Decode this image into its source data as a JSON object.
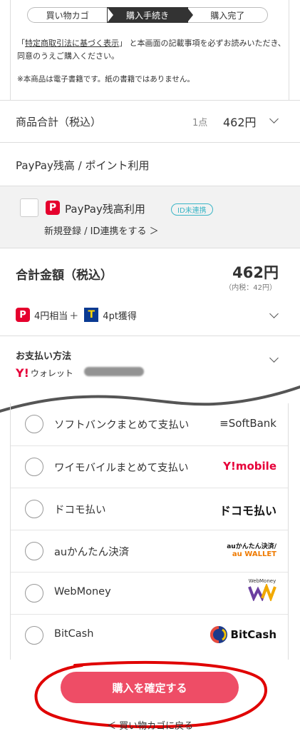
{
  "steps": [
    {
      "label": "買い物カゴ"
    },
    {
      "label": "購入手続き"
    },
    {
      "label": "購入完了"
    }
  ],
  "notice": {
    "quote_open": "「",
    "link": "特定商取引法に基づく表示",
    "quote_close": "」",
    "text": "と本画面の記載事項を必ずお読みいただき、同意のうえご購入ください。",
    "ebook_note": "※本商品は電子書籍です。紙の書籍ではありません。"
  },
  "subtotal": {
    "label": "商品合計（税込）",
    "count": "1点",
    "amount": "462円"
  },
  "paypay": {
    "section_title": "PayPay残高 / ポイント利用",
    "logo_glyph": "P",
    "use_label": "PayPay残高利用",
    "badge": "ID未連携",
    "link": "新規登録 / ID連携をする ＞"
  },
  "total": {
    "label": "合計金額（税込）",
    "amount": "462円",
    "tax": "（内税：42円）",
    "pp_points": "4円相当",
    "plus": "＋",
    "t_glyph": "T",
    "t_points": "4pt獲得"
  },
  "payment_method": {
    "label": "お支払い方法",
    "y_glyph": "Y!",
    "wallet": "ウォレット"
  },
  "options": [
    {
      "label": "ソフトバンクまとめて支払い",
      "logo": "≡SoftBank",
      "logo_color": "#333333"
    },
    {
      "label": "ワイモバイルまとめて支払い",
      "logo": "Y!mobile",
      "logo_color": "#e60039"
    },
    {
      "label": "ドコモ払い",
      "logo": "ドコモ払い",
      "logo_color": "#111111"
    },
    {
      "label": "auかんたん決済",
      "logo": "auかんたん決済/",
      "logo_sub": "au WALLET",
      "logo_color": "#111111"
    },
    {
      "label": "WebMoney",
      "logo": "WebMoney",
      "logo_color": "#111111"
    },
    {
      "label": "BitCash",
      "logo": "BitCash",
      "logo_color": "#111111"
    }
  ],
  "confirm_button": "購入を確定する",
  "back_link": "＜ 買い物カゴに戻る",
  "colors": {
    "accent_red": "#ee4d66",
    "paypay_red": "#e5002d",
    "badge_teal": "#3ab5c6",
    "annotation_red": "#e00000"
  }
}
